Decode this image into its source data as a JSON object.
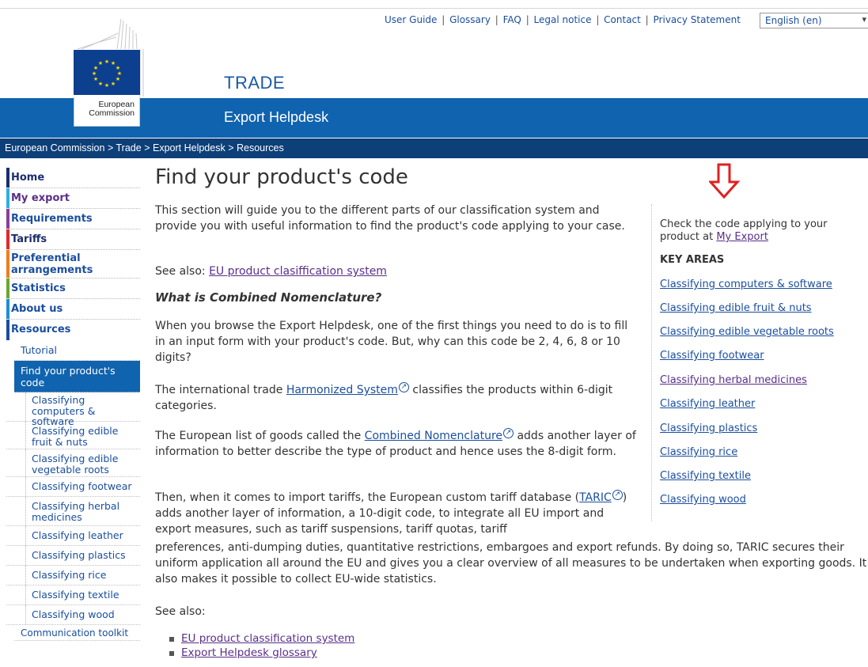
{
  "header": {
    "top_links": [
      "User Guide",
      "Glossary",
      "FAQ",
      "Legal notice",
      "Contact",
      "Privacy Statement"
    ],
    "language": "English (en)",
    "logo_line1": "European",
    "logo_line2": "Commission",
    "site_title": "TRADE",
    "banner_title": "Export Helpdesk"
  },
  "breadcrumb": [
    "European Commission",
    "Trade",
    "Export Helpdesk",
    "Resources"
  ],
  "breadcrumb_sep": ">",
  "nav": {
    "main": [
      {
        "label": "Home",
        "color": "#1a2d6e"
      },
      {
        "label": "My export",
        "color": "#2bb0e0"
      },
      {
        "label": "Requirements",
        "color": "#8a3f96"
      },
      {
        "label": "Tariffs",
        "color": "#e0282d"
      },
      {
        "label": "Preferential arrangements",
        "color": "#f07d1a"
      },
      {
        "label": "Statistics",
        "color": "#6aa72d"
      },
      {
        "label": "About us",
        "color": "#1a8fd8"
      },
      {
        "label": "Resources",
        "color": "#1a4e9e"
      }
    ],
    "sub": [
      "Tutorial",
      "Find your product's code"
    ],
    "subsub": [
      "Classifying computers & software",
      "Classifying edible fruit & nuts",
      "Classifying edible vegetable roots",
      "Classifying footwear",
      "Classifying herbal medicines",
      "Classifying leather",
      "Classifying plastics",
      "Classifying rice",
      "Classifying textile",
      "Classifying wood"
    ],
    "next": "Communication toolkit"
  },
  "main": {
    "title": "Find your product's code",
    "intro": "This section will guide you to the different parts of our classification system and provide you with useful information to find the product's code applying to your case.",
    "see_also_prefix": "See also: ",
    "see_also_link": "EU product clasiffication system",
    "subheading": "What is Combined Nomenclature?",
    "p1": "When you browse the Export Helpdesk, one of the first things you need to do is to fill in an input form with your product's code. But, why can this code be 2, 4, 6, 8 or 10 digits?",
    "p2_pre": "The international trade ",
    "p2_link": "Harmonized System",
    "p2_post": " classifies the products within 6-digit categories.",
    "p3_pre": "The European list of goods called the ",
    "p3_link": "Combined Nomenclature",
    "p3_post": " adds another layer of information to better describe the type of product and hence uses the 8-digit form.",
    "p4_pre": "Then, when it comes to import tariffs, the European custom tariff database (",
    "p4_link": "TARIC",
    "p4_post_a": ") adds another layer of information, a 10-digit code, to integrate all EU import and export measures, such as tariff suspensions, tariff quotas, tariff",
    "p4_post_b": "preferences, anti-dumping duties, quantitative restrictions, embargoes and export refunds. By doing so, TARIC secures their uniform application all around the EU and gives you a clear overview of all measures to be undertaken when exporting goods. It also makes it possible to collect EU-wide statistics.",
    "see_also_label": "See also:",
    "see_also_list": [
      "EU product classification system",
      "Export Helpdesk glossary"
    ]
  },
  "sidebar": {
    "check_text": "Check the code applying to your product at ",
    "check_link": "My Export",
    "key_areas": "KEY AREAS",
    "links": [
      "Classifying computers & software",
      "Classifying edible fruit & nuts",
      "Classifying edible vegetable roots",
      "Classifying footwear",
      "Classifying herbal medicines",
      "Classifying leather",
      "Classifying plastics",
      "Classifying rice",
      "Classifying textile",
      "Classifying wood"
    ]
  },
  "colors": {
    "banner": "#1063af",
    "breadcrumb_bar": "#0d3f78",
    "arrow": "#e02020",
    "link": "#1a4e9e"
  }
}
